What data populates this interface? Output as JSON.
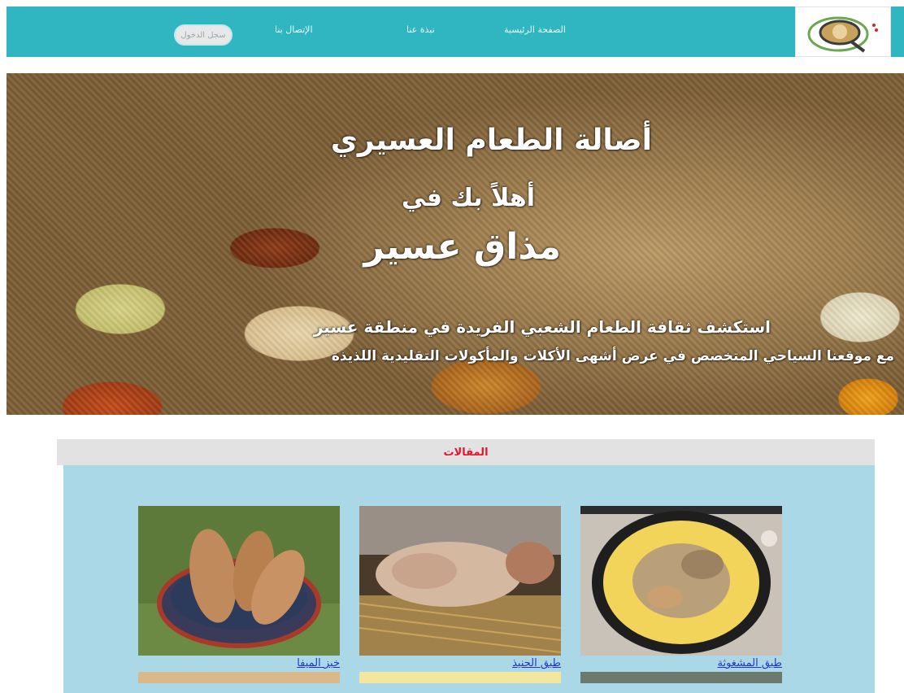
{
  "nav": {
    "links": [
      "الصفحة الرئيسية",
      "نبذة عنا",
      "الإتصال بنا"
    ],
    "pill_label": "سجل الدخول"
  },
  "hero": {
    "title": "أصالة الطعام العسيري",
    "welcome": "أهلاً بك في",
    "brand": "مذاق عسير",
    "line1": "استكشف ثقافة الطعام الشعبي الفريدة في منطقة عسير",
    "line2": "مع موقعنا السياحي المتخصص في عرض أشهى الأكلات والمأكولات التقليدية اللذيذة"
  },
  "articles": {
    "header": "المقالات",
    "items": [
      {
        "label": "طبق المشغوثة"
      },
      {
        "label": "طبق الحنيذ"
      },
      {
        "label": "خبز الميفا"
      }
    ]
  },
  "colors": {
    "topbar": "#2fb6c0",
    "articles_bg": "#aad8e6",
    "header_text": "#e0182a",
    "link": "#2233cc"
  }
}
